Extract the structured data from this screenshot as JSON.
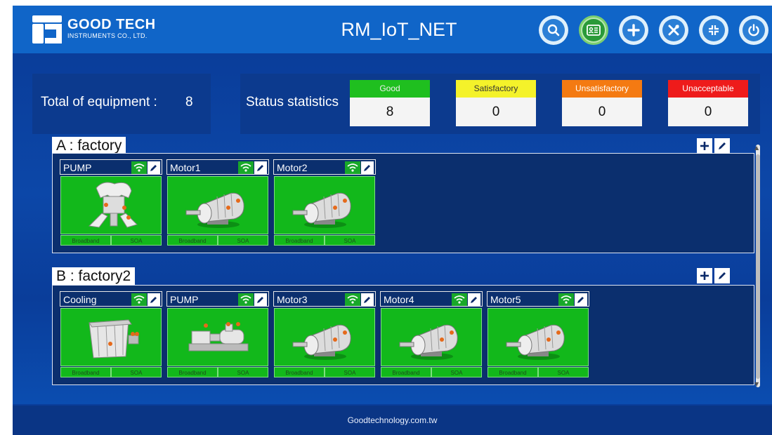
{
  "header": {
    "company_name": "GOOD TECH",
    "company_sub": "INSTRUMENTS CO., LTD.",
    "title": "RM_IoT_NET",
    "buttons": [
      "search-icon",
      "user-card-icon",
      "plus-icon",
      "tools-icon",
      "collapse-icon",
      "power-icon"
    ]
  },
  "summary": {
    "total_label": "Total of equipment :",
    "total_value": "8",
    "stats_label": "Status statistics",
    "statuses": [
      {
        "label": "Good",
        "value": "8",
        "color": "#1fbf1f",
        "text_color": "#f0f0f0"
      },
      {
        "label": "Satisfactory",
        "value": "0",
        "color": "#f4f22a",
        "text_color": "#333333"
      },
      {
        "label": "Unsatisfactory",
        "value": "0",
        "color": "#f47a12",
        "text_color": "#ffffff"
      },
      {
        "label": "Unacceptable",
        "value": "0",
        "color": "#ee1b1b",
        "text_color": "#ffffff"
      }
    ]
  },
  "groups": [
    {
      "title": "A : factory",
      "devices": [
        {
          "name": "PUMP",
          "image": "pump-icon",
          "meta": [
            "Broadband",
            "SOA"
          ]
        },
        {
          "name": "Motor1",
          "image": "motor-icon",
          "meta": [
            "Broadband",
            "SOA"
          ]
        },
        {
          "name": "Motor2",
          "image": "motor-icon",
          "meta": [
            "Broadband",
            "SOA"
          ]
        }
      ]
    },
    {
      "title": "B : factory2",
      "devices": [
        {
          "name": "Cooling",
          "image": "cooling-tower-icon",
          "meta": [
            "Broadband",
            "SOA"
          ]
        },
        {
          "name": "PUMP",
          "image": "pump-icon",
          "meta": [
            "Broadband",
            "SOA"
          ]
        },
        {
          "name": "Motor3",
          "image": "motor-icon",
          "meta": [
            "Broadband",
            "SOA"
          ]
        },
        {
          "name": "Motor4",
          "image": "motor-icon",
          "meta": [
            "Broadband",
            "SOA"
          ]
        },
        {
          "name": "Motor5",
          "image": "motor-icon",
          "meta": [
            "Broadband",
            "SOA"
          ]
        }
      ]
    }
  ],
  "footer": {
    "text": "Goodtechnology.com.tw"
  },
  "colors": {
    "header": "#1065c8",
    "body": "#0a3d9a",
    "card": "#12b81b"
  }
}
